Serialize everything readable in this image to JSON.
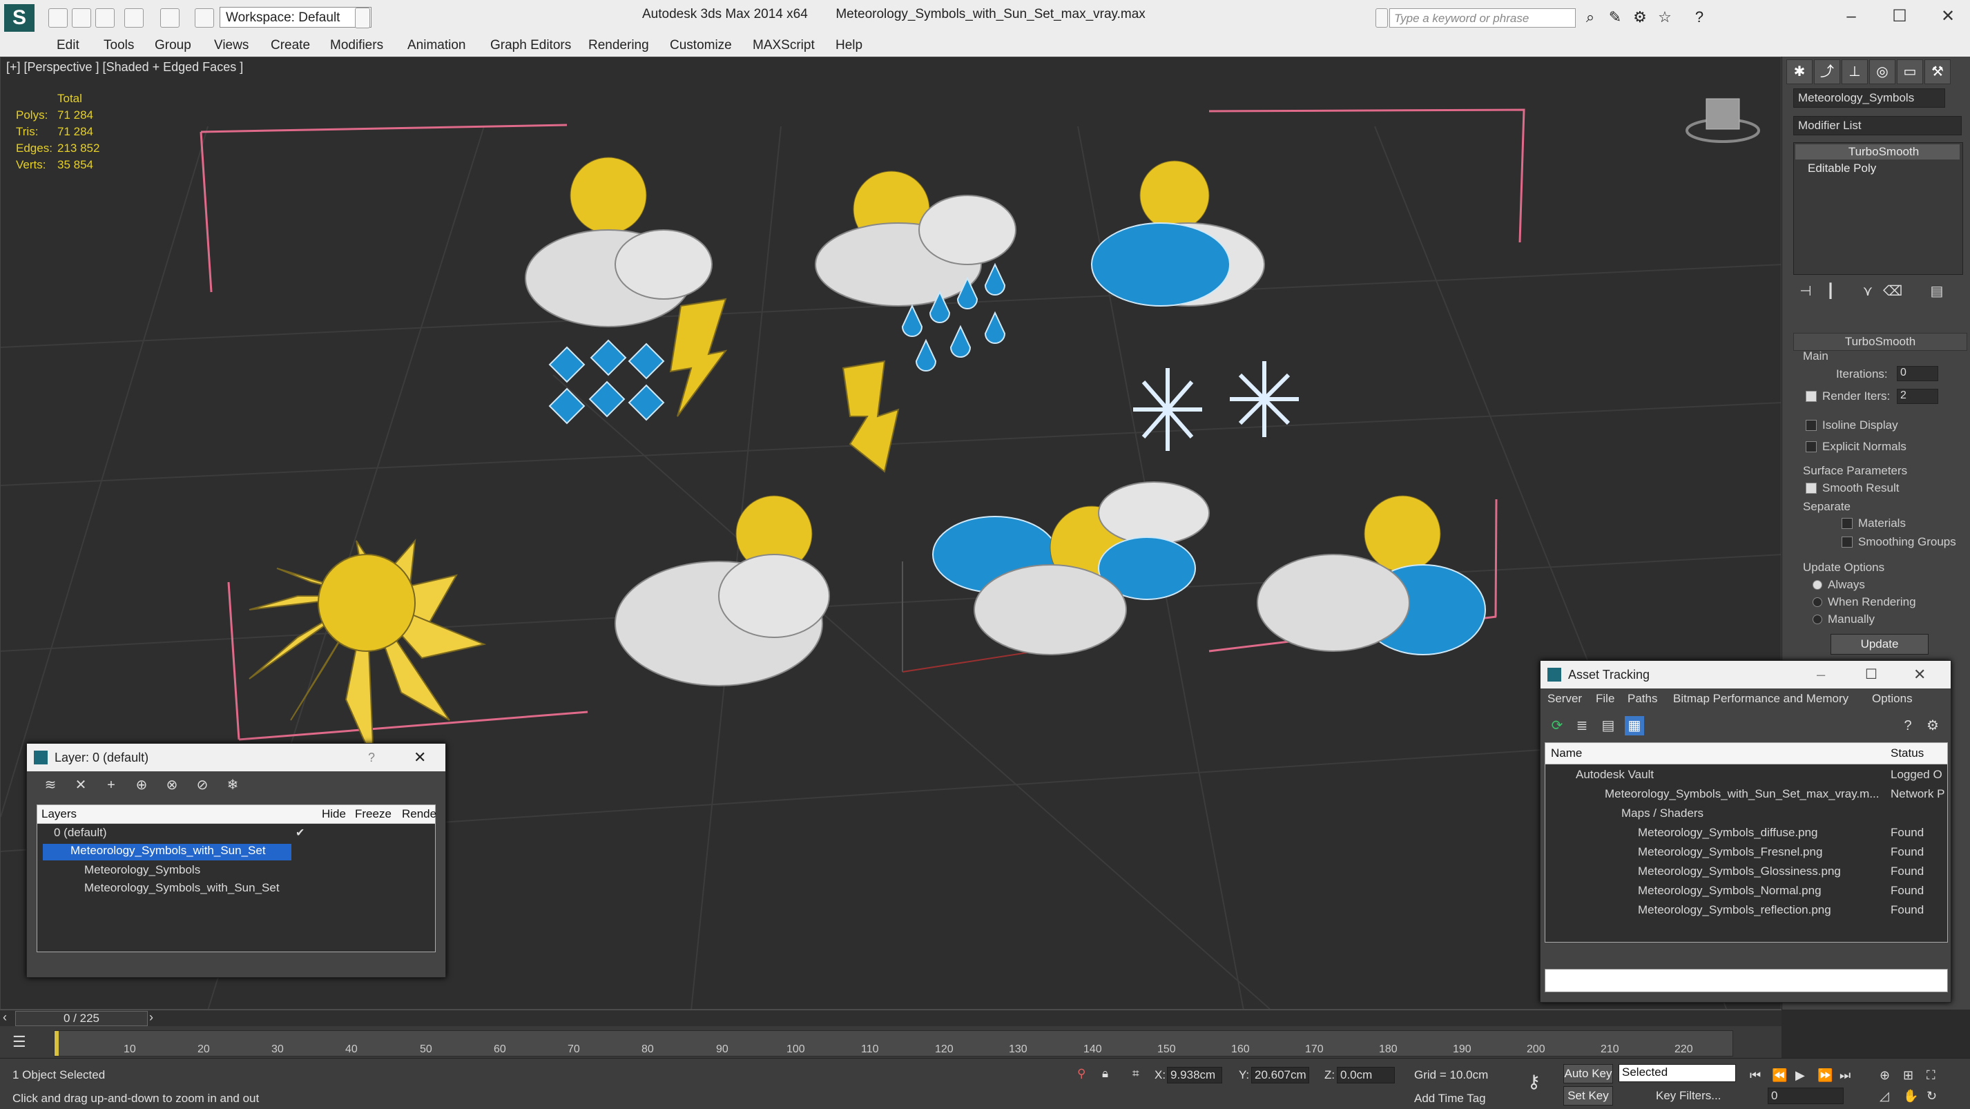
{
  "titlebar": {
    "workspace": "Workspace: Default",
    "app_name": "Autodesk 3ds Max  2014 x64",
    "file_name": "Meteorology_Symbols_with_Sun_Set_max_vray.max",
    "search_placeholder": "Type a keyword or phrase"
  },
  "menu": [
    "Edit",
    "Tools",
    "Group",
    "Views",
    "Create",
    "Modifiers",
    "Animation",
    "Graph Editors",
    "Rendering",
    "Customize",
    "MAXScript",
    "Help"
  ],
  "viewport": {
    "label": "[+] [Perspective ] [Shaded + Edged Faces ]",
    "stats": {
      "header": "Total",
      "rows": [
        {
          "label": "Polys:",
          "value": "71 284"
        },
        {
          "label": "Tris:",
          "value": "71 284"
        },
        {
          "label": "Edges:",
          "value": "213 852"
        },
        {
          "label": "Verts:",
          "value": "35 854"
        }
      ]
    }
  },
  "command_panel": {
    "object_name": "Meteorology_Symbols",
    "modifier_list": "Modifier List",
    "stack": [
      "TurboSmooth",
      "Editable Poly"
    ],
    "turbosmooth": {
      "title": "TurboSmooth",
      "main": "Main",
      "iterations_label": "Iterations:",
      "iterations_value": "0",
      "render_iters_label": "Render Iters:",
      "render_iters_value": "2",
      "isoline": "Isoline Display",
      "explicit_normals": "Explicit Normals",
      "surface_params": "Surface Parameters",
      "smooth_result": "Smooth Result",
      "separate": "Separate",
      "materials": "Materials",
      "smoothing_groups": "Smoothing Groups",
      "update_options": "Update Options",
      "always": "Always",
      "when_rendering": "When Rendering",
      "manually": "Manually",
      "update_btn": "Update"
    }
  },
  "layer_dialog": {
    "title": "Layer: 0 (default)",
    "help": "?",
    "columns": [
      "Layers",
      "Hide",
      "Freeze",
      "Rende"
    ],
    "rows": [
      "0 (default)",
      "Meteorology_Symbols_with_Sun_Set",
      "Meteorology_Symbols",
      "Meteorology_Symbols_with_Sun_Set"
    ]
  },
  "asset_tracking": {
    "title": "Asset Tracking",
    "menu": [
      "Server",
      "File",
      "Paths",
      "Bitmap Performance and Memory",
      "Options"
    ],
    "columns": [
      "Name",
      "Status"
    ],
    "rows": [
      {
        "name": "Autodesk Vault",
        "status": "Logged O"
      },
      {
        "name": "Meteorology_Symbols_with_Sun_Set_max_vray.m...",
        "status": "Network P"
      },
      {
        "name": "Maps / Shaders",
        "status": ""
      },
      {
        "name": "Meteorology_Symbols_diffuse.png",
        "status": "Found"
      },
      {
        "name": "Meteorology_Symbols_Fresnel.png",
        "status": "Found"
      },
      {
        "name": "Meteorology_Symbols_Glossiness.png",
        "status": "Found"
      },
      {
        "name": "Meteorology_Symbols_Normal.png",
        "status": "Found"
      },
      {
        "name": "Meteorology_Symbols_reflection.png",
        "status": "Found"
      }
    ]
  },
  "timeline": {
    "frame": "0 / 225",
    "ticks": [
      "10",
      "20",
      "30",
      "40",
      "50",
      "60",
      "70",
      "80",
      "90",
      "100",
      "110",
      "120",
      "130",
      "140",
      "150",
      "160",
      "170",
      "180",
      "190",
      "200",
      "210",
      "220"
    ]
  },
  "status": {
    "selected": "1 Object Selected",
    "hint": "Click and drag up-and-down to zoom in and out",
    "x_label": "X:",
    "x_value": "9.938cm",
    "y_label": "Y:",
    "y_value": "20.607cm",
    "z_label": "Z:",
    "z_value": "0.0cm",
    "grid": "Grid = 10.0cm",
    "auto_key": "Auto Key",
    "selected_mode": "Selected",
    "set_key": "Set Key",
    "key_filters": "Key Filters...",
    "add_time_tag": "Add Time Tag",
    "frame_value": "0"
  }
}
